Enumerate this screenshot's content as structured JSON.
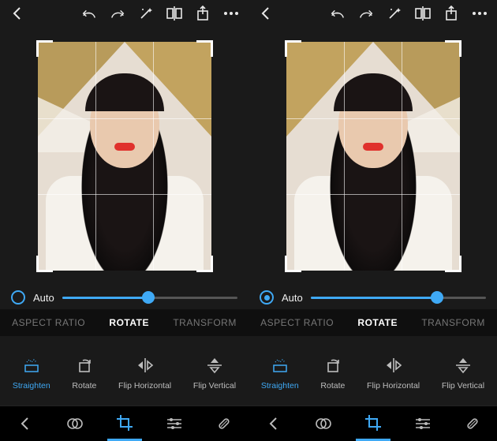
{
  "panes": [
    {
      "auto": {
        "label": "Auto",
        "selected": false
      },
      "slider": {
        "percent": 49
      },
      "tabs": {
        "aspect": "ASPECT RATIO",
        "rotate": "ROTATE",
        "transform": "TRANSFORM",
        "active": "rotate"
      },
      "tools": {
        "straighten": "Straighten",
        "rotate": "Rotate",
        "fliph": "Flip Horizontal",
        "flipv": "Flip Vertical",
        "active": "straighten"
      },
      "mirrored": false
    },
    {
      "auto": {
        "label": "Auto",
        "selected": true
      },
      "slider": {
        "percent": 72
      },
      "tabs": {
        "aspect": "ASPECT RATIO",
        "rotate": "ROTATE",
        "transform": "TRANSFORM",
        "active": "rotate"
      },
      "tools": {
        "straighten": "Straighten",
        "rotate": "Rotate",
        "fliph": "Flip Horizontal",
        "flipv": "Flip Vertical",
        "active": "straighten"
      },
      "mirrored": true
    }
  ],
  "colors": {
    "accent": "#3fa9f5"
  }
}
